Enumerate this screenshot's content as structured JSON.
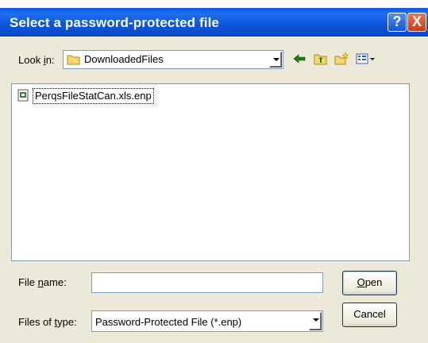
{
  "window": {
    "title": "Select a password-protected file",
    "help_glyph": "?",
    "close_glyph": "X"
  },
  "look_in": {
    "label_pre": "Look ",
    "label_ul": "i",
    "label_post": "n:",
    "value": "DownloadedFiles",
    "icon": "folder-icon"
  },
  "toolbar": {
    "back_icon": "back-arrow-icon",
    "up_icon": "up-one-level-icon",
    "new_folder_icon": "new-folder-icon",
    "views_icon": "view-menu-icon"
  },
  "files": [
    {
      "name": "PerqsFileStatCan.xls.enp",
      "icon": "enp-file-icon"
    }
  ],
  "file_name": {
    "label_pre": "File ",
    "label_ul": "n",
    "label_post": "ame:",
    "value": ""
  },
  "file_type": {
    "label_pre": "Files of ",
    "label_ul": "t",
    "label_post": "ype:",
    "value": "Password-Protected File (*.enp)"
  },
  "buttons": {
    "open_ul": "O",
    "open_rest": "pen",
    "cancel": "Cancel"
  },
  "colors": {
    "title_bar": "#0a5be0",
    "dialog_bg": "#ece9d8",
    "input_border": "#7f9db9",
    "close_button": "#c63a12"
  }
}
